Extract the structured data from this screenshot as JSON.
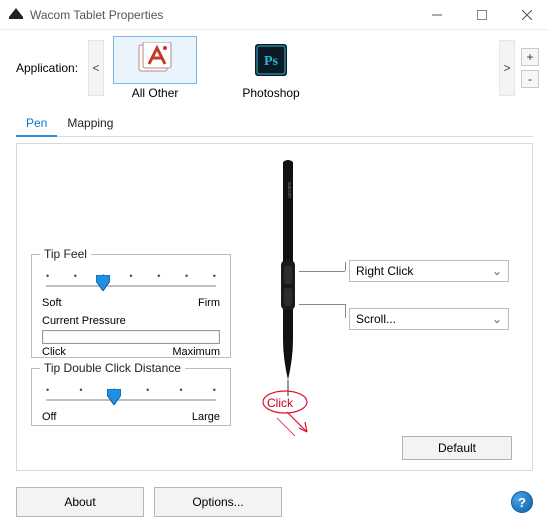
{
  "window": {
    "title": "Wacom Tablet Properties"
  },
  "app_row": {
    "label": "Application:",
    "items": [
      {
        "name": "All Other",
        "selected": true
      },
      {
        "name": "Photoshop",
        "selected": false
      }
    ],
    "scroll_left": "<",
    "scroll_right": ">",
    "add": "+",
    "remove": "-"
  },
  "tabs": {
    "items": [
      "Pen",
      "Mapping"
    ],
    "active": 0
  },
  "tipfeel": {
    "legend": "Tip Feel",
    "min": "Soft",
    "max": "Firm",
    "ticks": 7,
    "value_index": 2,
    "pressure_label": "Current Pressure",
    "pressure_min": "Click",
    "pressure_max": "Maximum"
  },
  "tipdbl": {
    "legend": "Tip Double Click Distance",
    "min": "Off",
    "max": "Large",
    "ticks": 6,
    "value_index": 2
  },
  "button_top": {
    "label": "Right Click"
  },
  "button_mid": {
    "label": "Scroll..."
  },
  "tip_action": {
    "label": "Click"
  },
  "default_btn": "Default",
  "footer": {
    "about": "About",
    "options": "Options...",
    "help": "?"
  }
}
